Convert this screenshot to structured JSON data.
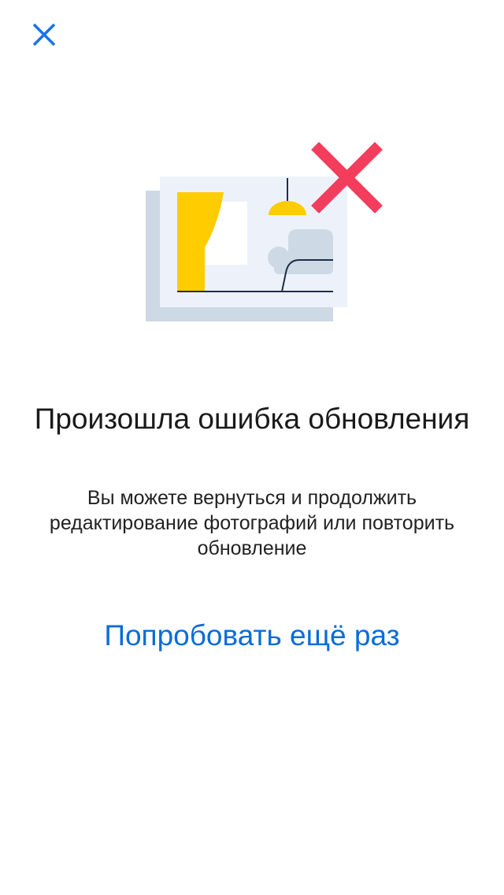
{
  "error_screen": {
    "title": "Произошла ошибка обновления",
    "message": "Вы можете вернуться и продолжить редактирование фотографий или повторить обновление",
    "retry_label": "Попробовать ещё раз"
  },
  "icons": {
    "close": "close-icon",
    "illustration": "broken-photo-illustration"
  },
  "colors": {
    "accent": "#0a6cd8",
    "close_icon": "#1a73e8",
    "error_cross": "#f23d5c",
    "curtain": "#ffcc00",
    "lamp": "#ffcc00",
    "photo_back": "#cdd9e4",
    "photo_front": "#edf2fa",
    "sofa": "#cdd9e4",
    "line": "#1f2d4a"
  }
}
